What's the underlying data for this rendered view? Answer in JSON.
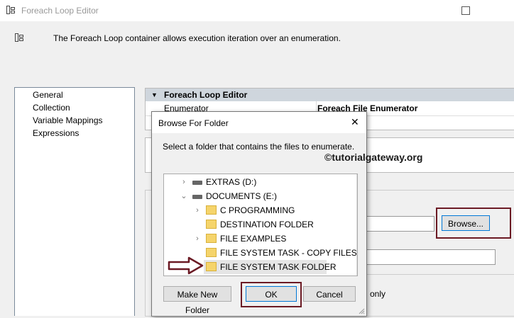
{
  "window": {
    "title": "Foreach Loop Editor"
  },
  "description": "The Foreach Loop container allows execution iteration over an enumeration.",
  "nav": {
    "items": [
      "General",
      "Collection",
      "Variable Mappings",
      "Expressions"
    ]
  },
  "property_grid": {
    "header": "Foreach Loop Editor",
    "enumerator_label": "Enumerator",
    "enumerator_value": "Foreach File Enumerator"
  },
  "browse_button": "Browse...",
  "only_text": "only",
  "dialog": {
    "title": "Browse For Folder",
    "instruction": "Select a folder that contains the files to enumerate.",
    "watermark": "©tutorialgateway.org",
    "tree": [
      {
        "label": "EXTRAS (D:)",
        "type": "drive",
        "chevron": "›"
      },
      {
        "label": "DOCUMENTS (E:)",
        "type": "drive",
        "chevron": "⌄"
      },
      {
        "label": "C PROGRAMMING",
        "type": "folder",
        "chevron": "›"
      },
      {
        "label": "DESTINATION FOLDER",
        "type": "folder",
        "chevron": ""
      },
      {
        "label": "FILE EXAMPLES",
        "type": "folder",
        "chevron": "›"
      },
      {
        "label": "FILE SYSTEM TASK - COPY FILES",
        "type": "folder",
        "chevron": ""
      },
      {
        "label": "FILE SYSTEM TASK FOLDER",
        "type": "folder",
        "chevron": "",
        "selected": true
      }
    ],
    "buttons": {
      "new_folder": "Make New Folder",
      "ok": "OK",
      "cancel": "Cancel"
    }
  },
  "colors": {
    "highlight_border": "#6b1a24",
    "accent": "#0078d7",
    "grid_header": "#cfd6dd"
  }
}
